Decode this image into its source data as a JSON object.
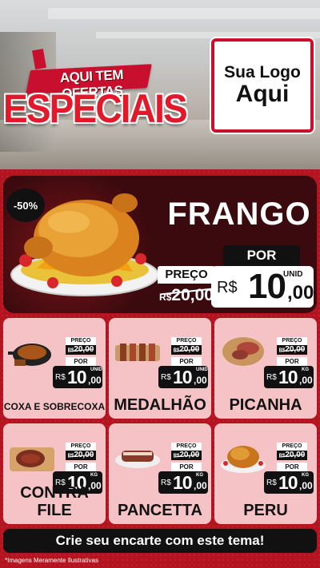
{
  "header": {
    "ribbon_text": "AQUI TEM OFERTAS",
    "title": "ESPECIAIS",
    "logo_line1": "Sua Logo",
    "logo_line2": "Aqui"
  },
  "featured": {
    "discount": "-50%",
    "name": "FRANGO",
    "old_label": "PREÇO",
    "old_currency": "R$",
    "old_price": "20,00",
    "new_label": "POR",
    "new_currency": "R$",
    "new_int": "10",
    "new_dec": ",00",
    "unit": "UNID",
    "image_icon": "roast-chicken-icon"
  },
  "products": [
    {
      "name": "COXA E SOBRECOXA",
      "old_label": "PREÇO",
      "old_currency": "R$",
      "old_price": "20,00",
      "new_label": "POR",
      "currency": "R$",
      "int": "10",
      "dec": ",00",
      "unit": "UNID",
      "icon": "chicken-pan-icon"
    },
    {
      "name": "MEDALHÃO",
      "old_label": "PREÇO",
      "old_currency": "R$",
      "old_price": "20,00",
      "new_label": "POR",
      "currency": "R$",
      "int": "10",
      "dec": ",00",
      "unit": "UNID",
      "icon": "skewers-icon"
    },
    {
      "name": "PICANHA",
      "old_label": "PREÇO",
      "old_currency": "R$",
      "old_price": "20,00",
      "new_label": "POR",
      "currency": "R$",
      "int": "10",
      "dec": ",00",
      "unit": "KG",
      "icon": "picanha-board-icon"
    },
    {
      "name": "CONTRA FILE",
      "old_label": "PREÇO",
      "old_currency": "R$",
      "old_price": "20,00",
      "new_label": "POR",
      "currency": "R$",
      "int": "10",
      "dec": ",00",
      "unit": "KG",
      "icon": "steak-board-icon"
    },
    {
      "name": "PANCETTA",
      "old_label": "PREÇO",
      "old_currency": "R$",
      "old_price": "20,00",
      "new_label": "POR",
      "currency": "R$",
      "int": "10",
      "dec": ",00",
      "unit": "KG",
      "icon": "pancetta-icon"
    },
    {
      "name": "PERU",
      "old_label": "PREÇO",
      "old_currency": "R$",
      "old_price": "20,00",
      "new_label": "POR",
      "currency": "R$",
      "int": "10",
      "dec": ",00",
      "unit": "KG",
      "icon": "roast-turkey-icon"
    }
  ],
  "cta": "Crie seu encarte com este tema!",
  "footnote": "*Imagens Meramente Ilustrativas",
  "colors": {
    "brand_red": "#c8102e",
    "dark": "#111111",
    "card_pink": "#f5c3c6",
    "panel_dark": "#3a0a0e"
  }
}
